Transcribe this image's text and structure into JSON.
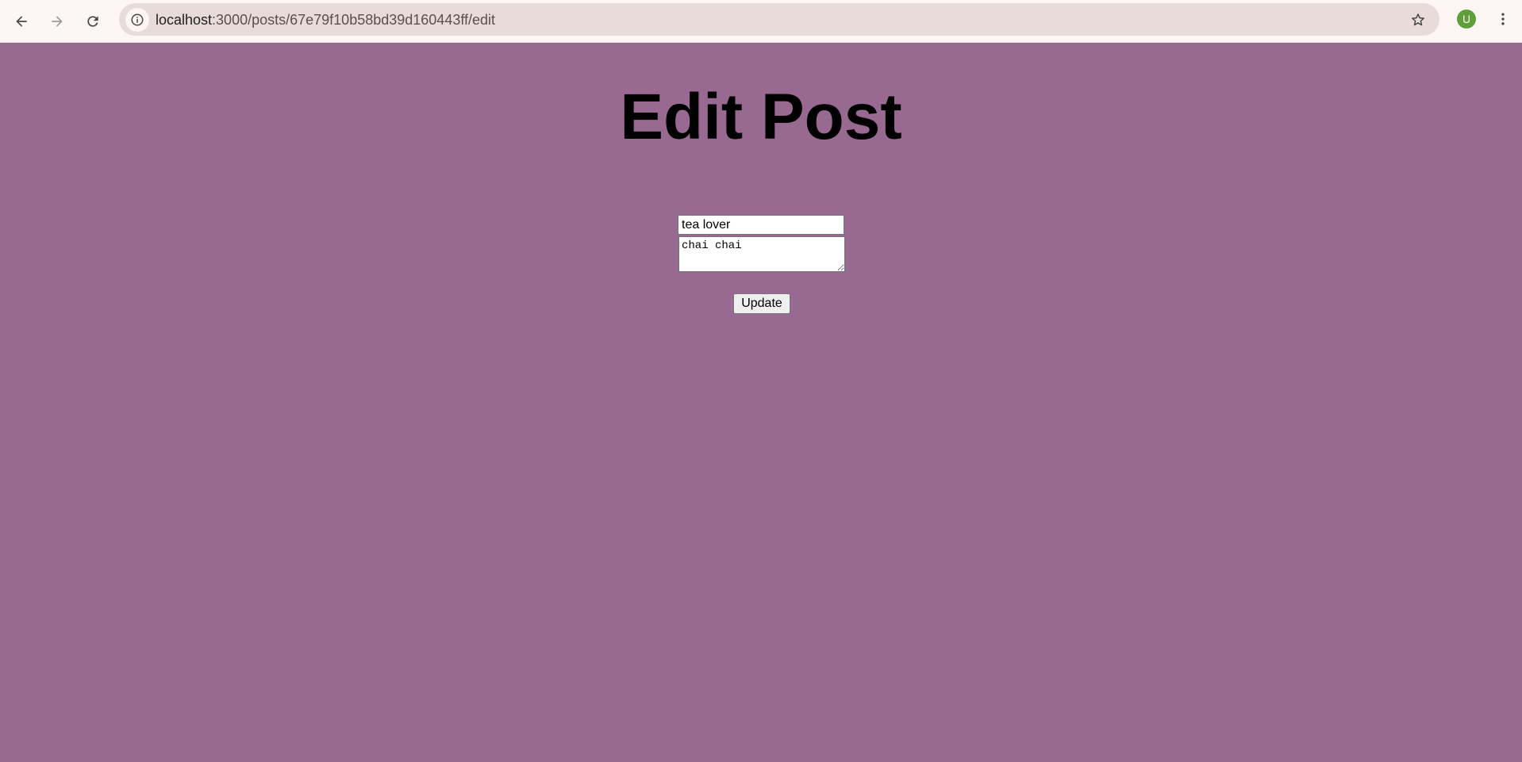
{
  "browser": {
    "url_host": "localhost",
    "url_rest": ":3000/posts/67e79f10b58bd39d160443ff/edit",
    "profile_initial": "U",
    "icons": {
      "back": "back-arrow-icon",
      "forward": "forward-arrow-icon",
      "reload": "reload-icon",
      "site_info": "info-icon",
      "bookmark": "star-icon",
      "menu": "kebab-menu-icon"
    },
    "colors": {
      "toolbar": "#fdf6f5",
      "omnibox": "#e8dcdb",
      "avatar": "#5f9e3a"
    }
  },
  "page": {
    "background": "#996a91",
    "title": "Edit Post",
    "form": {
      "title_value": "tea lover",
      "content_value": "chai chai",
      "submit_label": "Update"
    }
  }
}
